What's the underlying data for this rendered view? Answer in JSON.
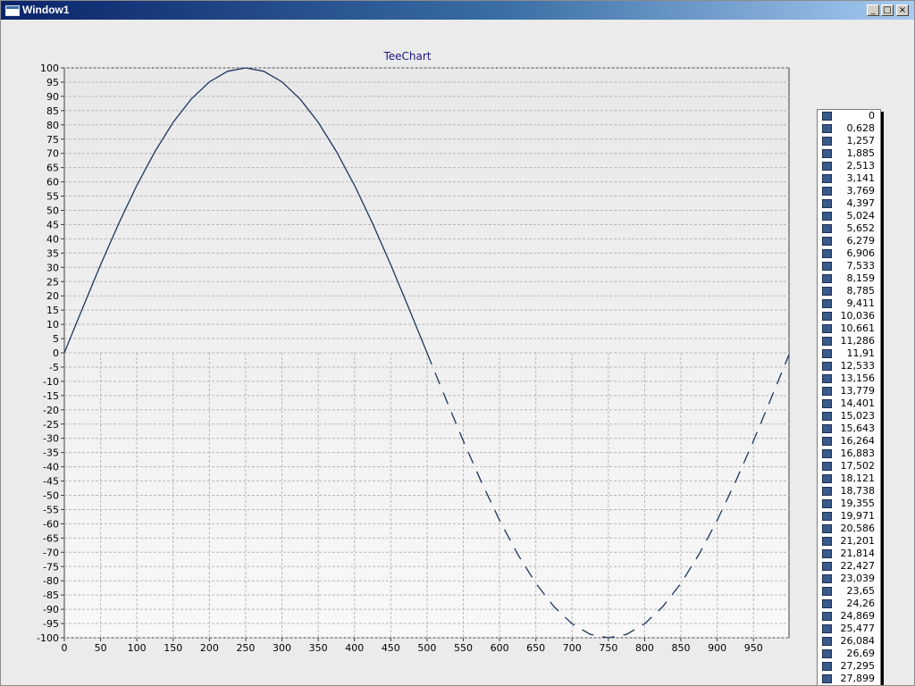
{
  "window": {
    "title": "Window1",
    "minimize_glyph": "_",
    "maximize_glyph": "□",
    "close_glyph": "×"
  },
  "colors": {
    "series_line": "#1f3560",
    "grid": "#b8b8b8",
    "title_text": "#1a1a80",
    "legend_swatch": "#3a5a8c"
  },
  "chart_data": {
    "type": "line",
    "title": "TeeChart",
    "xlabel": "",
    "ylabel": "",
    "xlim": [
      0,
      999
    ],
    "ylim": [
      -100,
      100
    ],
    "x_ticks": [
      0,
      50,
      100,
      150,
      200,
      250,
      300,
      350,
      400,
      450,
      500,
      550,
      600,
      650,
      700,
      750,
      800,
      850,
      900,
      950
    ],
    "y_ticks": [
      100,
      95,
      90,
      85,
      80,
      75,
      70,
      65,
      60,
      55,
      50,
      45,
      40,
      35,
      30,
      25,
      20,
      15,
      10,
      5,
      0,
      -5,
      -10,
      -15,
      -20,
      -25,
      -30,
      -35,
      -40,
      -45,
      -50,
      -55,
      -60,
      -65,
      -70,
      -75,
      -80,
      -85,
      -90,
      -95,
      -100
    ],
    "grid": true,
    "legend": "right",
    "series": [
      {
        "style": "solid",
        "x": [
          0,
          25,
          50,
          75,
          100,
          125,
          150,
          175,
          200,
          225,
          250,
          275,
          300,
          325,
          350,
          375,
          400,
          425,
          450,
          475,
          500
        ],
        "y": [
          0,
          15.6,
          30.9,
          45.4,
          58.8,
          70.7,
          80.9,
          89.1,
          95.1,
          98.8,
          100,
          98.8,
          95.1,
          89.1,
          80.9,
          70.7,
          58.8,
          45.4,
          30.9,
          15.6,
          0
        ]
      },
      {
        "style": "dashed",
        "x": [
          500,
          525,
          550,
          575,
          600,
          625,
          650,
          675,
          700,
          725,
          750,
          775,
          800,
          825,
          850,
          875,
          900,
          925,
          950,
          975,
          999
        ],
        "y": [
          0,
          -15.6,
          -30.9,
          -45.4,
          -58.8,
          -70.7,
          -80.9,
          -89.1,
          -95.1,
          -98.8,
          -100,
          -98.8,
          -95.1,
          -89.1,
          -80.9,
          -70.7,
          -58.8,
          -45.4,
          -30.9,
          -15.6,
          -0.6
        ]
      }
    ]
  },
  "legend": {
    "items": [
      "0",
      "0,628",
      "1,257",
      "1,885",
      "2,513",
      "3,141",
      "3,769",
      "4,397",
      "5,024",
      "5,652",
      "6,279",
      "6,906",
      "7,533",
      "8,159",
      "8,785",
      "9,411",
      "10,036",
      "10,661",
      "11,286",
      "11,91",
      "12,533",
      "13,156",
      "13,779",
      "14,401",
      "15,023",
      "15,643",
      "16,264",
      "16,883",
      "17,502",
      "18,121",
      "18,738",
      "19,355",
      "19,971",
      "20,586",
      "21,201",
      "21,814",
      "22,427",
      "23,039",
      "23,65",
      "24,26",
      "24,869",
      "25,477",
      "26,084",
      "26,69",
      "27,295",
      "27,899"
    ]
  }
}
